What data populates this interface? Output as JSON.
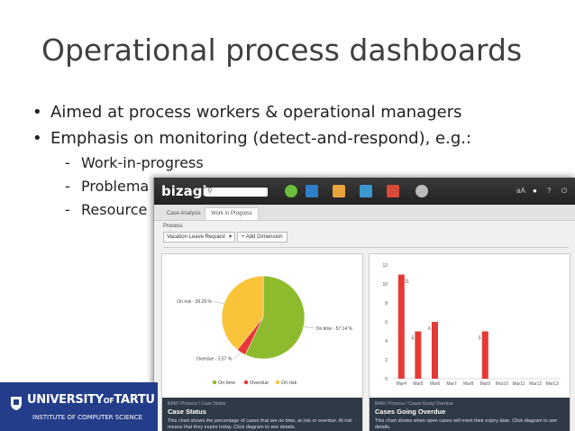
{
  "slide": {
    "title": "Operational process dashboards",
    "bullets": [
      "Aimed at process workers & operational managers",
      "Emphasis on monitoring (detect-and-respond), e.g.:"
    ],
    "subbullets": [
      "Work-in-progress",
      "Problema",
      "Resource"
    ],
    "bullet_glyph": "•",
    "dash_glyph": "-"
  },
  "university": {
    "name_a": "UNIVERSITY",
    "name_of": "OF",
    "name_b": "TARTU",
    "institute": "INSTITUTE OF COMPUTER SCIENCE"
  },
  "app": {
    "logo": "bizagi",
    "search_icon": "search-icon",
    "user_initials": "aA",
    "tabs": [
      "Case Analysis",
      "Work in Progress"
    ],
    "active_tab": 1,
    "process_label": "Process",
    "process_value": "Vacation Leave Request",
    "add_dimension": "+ Add Dimension",
    "accent_red": "#e53935",
    "accent_green": "#8dbb2d",
    "accent_yellow": "#f9c43a"
  },
  "panels": {
    "case_status": {
      "breadcrumb": "BAM / Process / Case Status",
      "title": "Case Status",
      "description": "This chart shows the percentage of cases that are on time, at risk or overdue. At risk means that they expire today. Click diagram to see details."
    },
    "overdue": {
      "breadcrumb": "BAM / Process / Cases Going Overdue",
      "title": "Cases Going Overdue",
      "description": "This chart shows when open cases will meet their expiry date. Click diagram to see details."
    }
  },
  "chart_data": [
    {
      "type": "pie",
      "labels": [
        "On time",
        "Overdue",
        "On risk"
      ],
      "values": [
        57.14,
        3.57,
        39.29
      ],
      "slice_labels": [
        "On time - 57.14 %",
        "Overdue - 3.57 %",
        "On risk - 39.29 %"
      ],
      "colors": [
        "#8dbb2d",
        "#e53935",
        "#f9c43a"
      ],
      "legend": "bottom"
    },
    {
      "type": "bar",
      "categories": [
        "Mar4",
        "Mar5",
        "Mar6",
        "Mar7",
        "Mar8",
        "Mar9",
        "Mar10",
        "Mar11",
        "Mar12",
        "Mar13"
      ],
      "values": [
        11,
        5,
        6,
        0,
        0,
        5,
        0,
        0,
        0,
        0
      ],
      "data_labels": [
        "11",
        "5",
        "6",
        "",
        "",
        "5",
        "",
        "",
        "",
        ""
      ],
      "yticks": [
        "0",
        "2",
        "4",
        "6",
        "8",
        "10",
        "12"
      ],
      "ylim": [
        0,
        12
      ],
      "grid": false,
      "color": "#e53935"
    }
  ]
}
